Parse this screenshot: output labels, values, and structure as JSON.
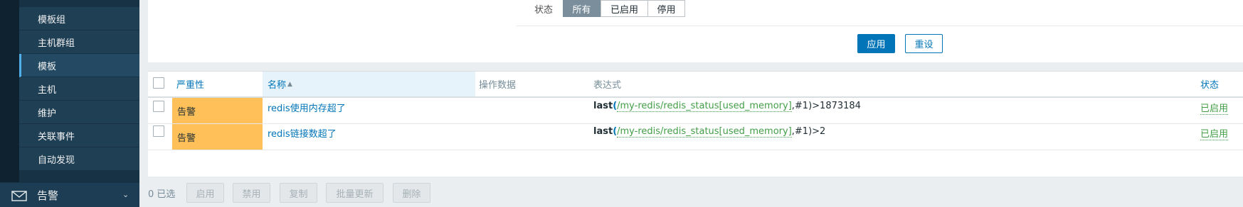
{
  "sidebar": {
    "items": [
      {
        "label": "模板组"
      },
      {
        "label": "主机群组"
      },
      {
        "label": "模板"
      },
      {
        "label": "主机"
      },
      {
        "label": "维护"
      },
      {
        "label": "关联事件"
      },
      {
        "label": "自动发现"
      }
    ],
    "active_item": "模板",
    "alerts_section": {
      "label": "告警",
      "icon": "mail-icon"
    }
  },
  "filter": {
    "status_label": "状态",
    "status_options": [
      "所有",
      "已启用",
      "停用"
    ],
    "status_selected": "所有",
    "apply_label": "应用",
    "reset_label": "重设"
  },
  "table": {
    "headers": {
      "severity": "严重性",
      "name": "名称",
      "operational_data": "操作数据",
      "expression": "表达式",
      "status": "状态"
    },
    "sort_indicator": "▲",
    "rows": [
      {
        "severity": "告警",
        "name": "redis使用内存超了",
        "operational_data": "",
        "expr_fn": "last",
        "expr_open": "(",
        "expr_item": "/my-redis/redis_status[used_memory]",
        "expr_rest": ",#1)>1873184",
        "status": "已启用"
      },
      {
        "severity": "告警",
        "name": "redis链接数超了",
        "operational_data": "",
        "expr_fn": "last",
        "expr_open": "(",
        "expr_item": "/my-redis/redis_status[used_memory]",
        "expr_rest": ",#1)>2",
        "status": "已启用"
      }
    ]
  },
  "footer": {
    "selected_count": "0 已选",
    "buttons": [
      "启用",
      "禁用",
      "复制",
      "批量更新",
      "删除"
    ]
  },
  "colors": {
    "sidebar_bg": "#173244",
    "accent": "#0275b8",
    "warning": "#ffc059",
    "enabled": "#429e47"
  }
}
